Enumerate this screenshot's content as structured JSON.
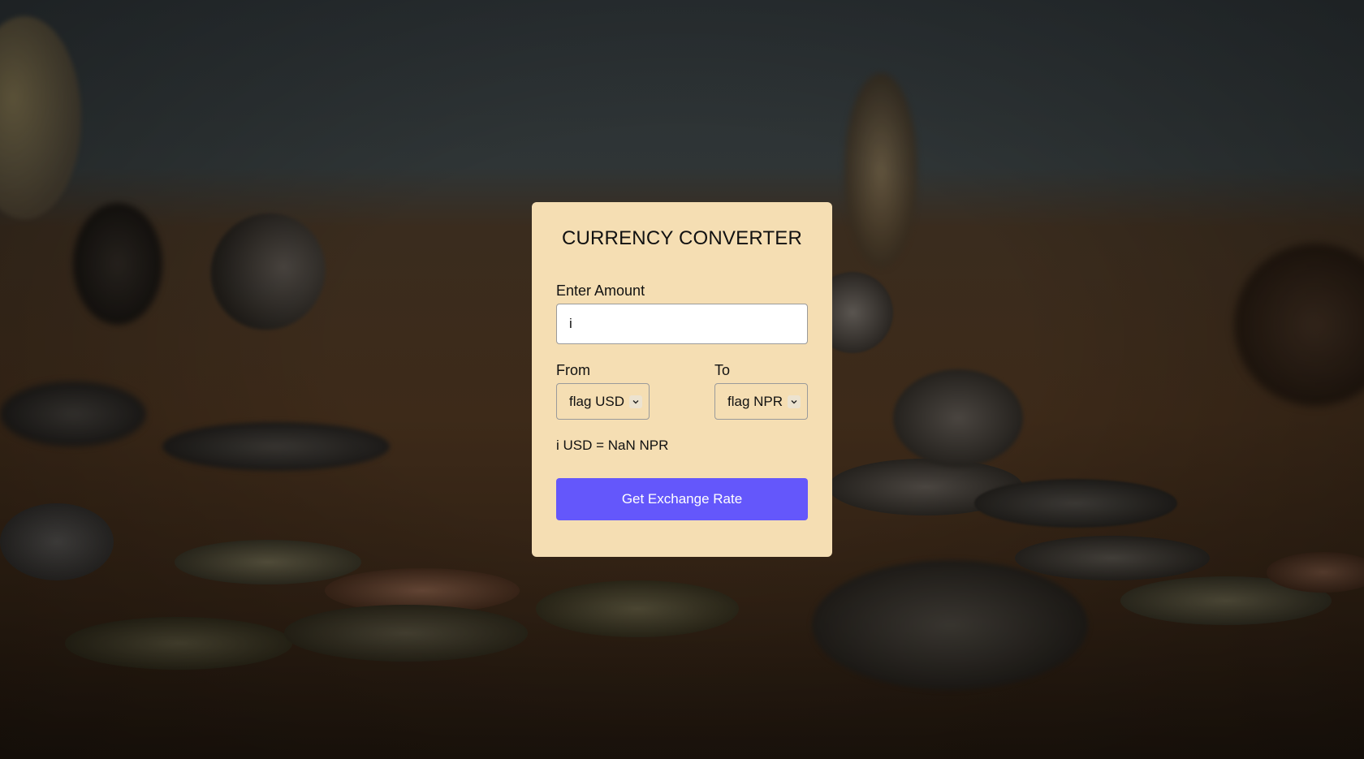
{
  "app": {
    "title": "CURRENCY CONVERTER"
  },
  "amount": {
    "label": "Enter Amount",
    "value": "i"
  },
  "from": {
    "label": "From",
    "selected": "flag USD",
    "icon": "chevron-down-icon"
  },
  "to": {
    "label": "To",
    "selected": "flag NPR",
    "icon": "chevron-down-icon"
  },
  "result": {
    "text": "i USD = NaN NPR"
  },
  "action": {
    "button_label": "Get Exchange Rate"
  },
  "colors": {
    "card_background": "#f5deb3",
    "button_background": "#6457fb",
    "button_text": "#ffffff"
  }
}
